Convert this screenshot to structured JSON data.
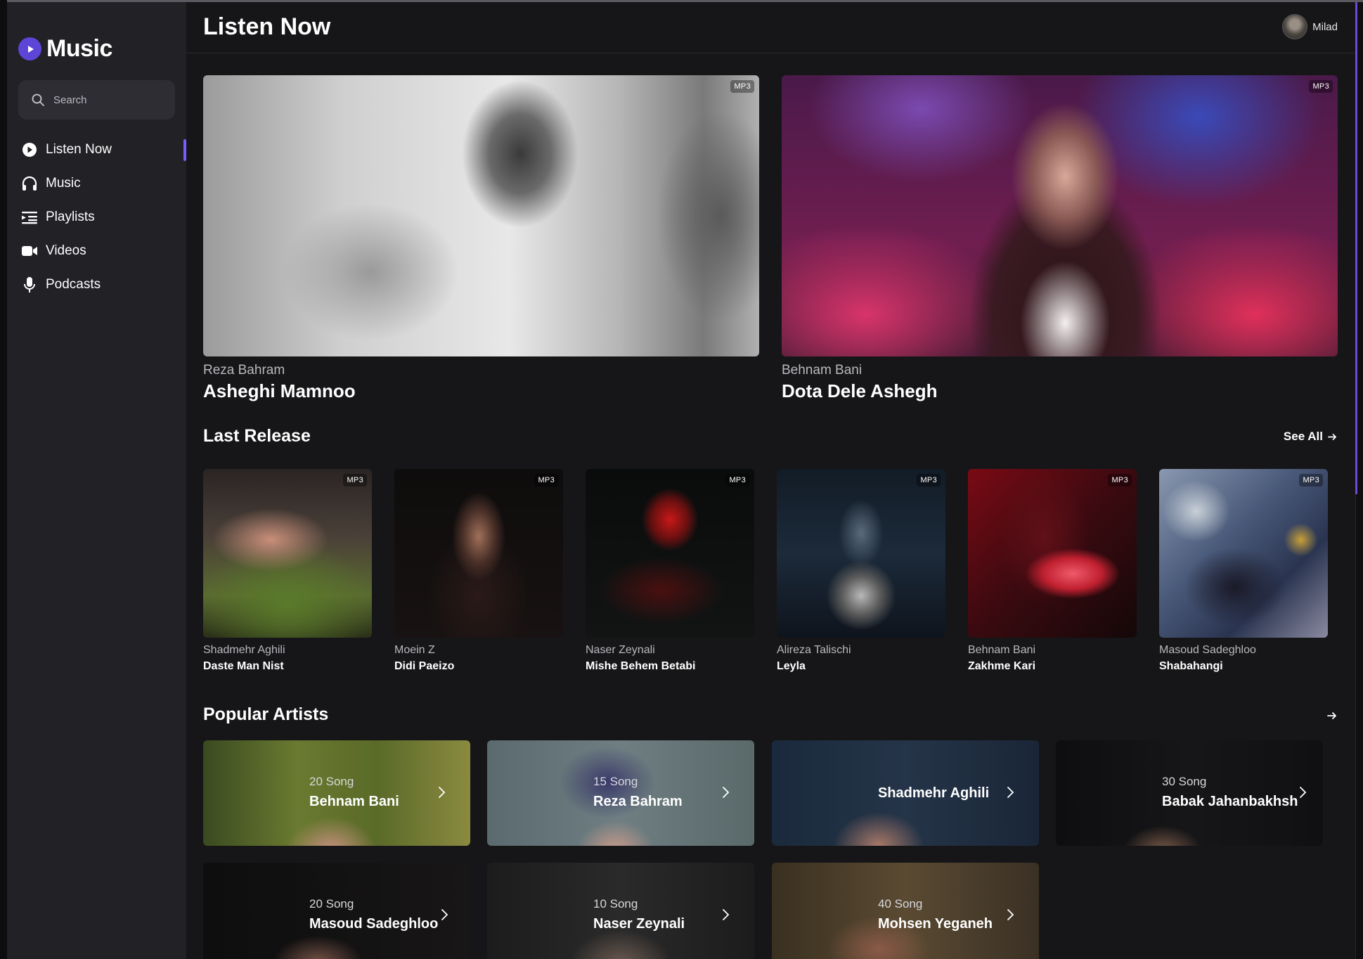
{
  "app": {
    "name": "Music"
  },
  "search": {
    "placeholder": "Search"
  },
  "nav": [
    {
      "label": "Listen Now",
      "icon": "play-circle-icon"
    },
    {
      "label": "Music",
      "icon": "headphones-icon"
    },
    {
      "label": "Playlists",
      "icon": "playlist-icon"
    },
    {
      "label": "Videos",
      "icon": "video-camera-icon"
    },
    {
      "label": "Podcasts",
      "icon": "microphone-icon"
    }
  ],
  "header": {
    "title": "Listen Now",
    "user_name": "Milad"
  },
  "featured": [
    {
      "badge": "MP3",
      "artist": "Reza Bahram",
      "song": "Asheghi Mamnoo"
    },
    {
      "badge": "MP3",
      "artist": "Behnam Bani",
      "song": "Dota Dele Ashegh"
    }
  ],
  "last_release": {
    "title": "Last Release",
    "see_all": "See All",
    "items": [
      {
        "badge": "MP3",
        "artist": "Shadmehr Aghili",
        "song": "Daste Man Nist"
      },
      {
        "badge": "MP3",
        "artist": "Moein Z",
        "song": "Didi Paeizo"
      },
      {
        "badge": "MP3",
        "artist": "Naser Zeynali",
        "song": "Mishe Behem Betabi"
      },
      {
        "badge": "MP3",
        "artist": "Alireza Talischi",
        "song": "Leyla"
      },
      {
        "badge": "MP3",
        "artist": "Behnam Bani",
        "song": "Zakhme Kari"
      },
      {
        "badge": "MP3",
        "artist": "Masoud Sadeghloo",
        "song": "Shabahangi"
      }
    ]
  },
  "popular_artists": {
    "title": "Popular Artists",
    "items": [
      {
        "count": "20 Song",
        "name": "Behnam Bani"
      },
      {
        "count": "15 Song",
        "name": "Reza Bahram"
      },
      {
        "count": "",
        "name": "Shadmehr Aghili"
      },
      {
        "count": "30 Song",
        "name": "Babak Jahanbakhsh"
      },
      {
        "count": "20 Song",
        "name": "Masoud Sadeghloo"
      },
      {
        "count": "10 Song",
        "name": "Naser Zeynali"
      },
      {
        "count": "40 Song",
        "name": "Mohsen Yeganeh"
      }
    ]
  },
  "colors": {
    "accent": "#5d45d8",
    "background": "#161618",
    "sidebar": "#212126"
  }
}
